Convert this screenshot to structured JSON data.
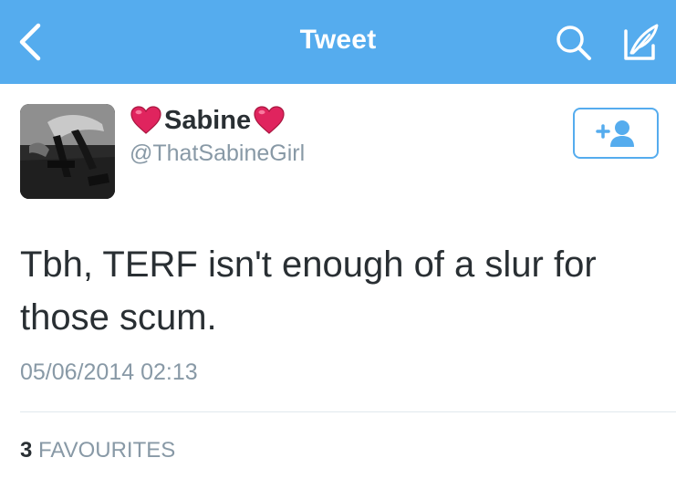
{
  "navbar": {
    "title": "Tweet",
    "back_icon": "back-chevron-icon",
    "search_icon": "search-icon",
    "compose_icon": "compose-tweet-icon",
    "background": "#55acee"
  },
  "tweet": {
    "author": {
      "display_name": "Sabine",
      "name_decoration_icon": "red-heart-emoji",
      "handle": "@ThatSabineGirl"
    },
    "follow_button_icon": "follow-person-plus-icon",
    "text": "Tbh, TERF isn't enough of a slur for those scum.",
    "timestamp": "05/06/2014 02:13",
    "stats": {
      "favourites_count": "3",
      "favourites_label": "FAVOURITES"
    }
  },
  "colors": {
    "accent": "#55acee",
    "primary_text": "#292f33",
    "secondary_text": "#8899a6",
    "heart": "#e0245e"
  }
}
